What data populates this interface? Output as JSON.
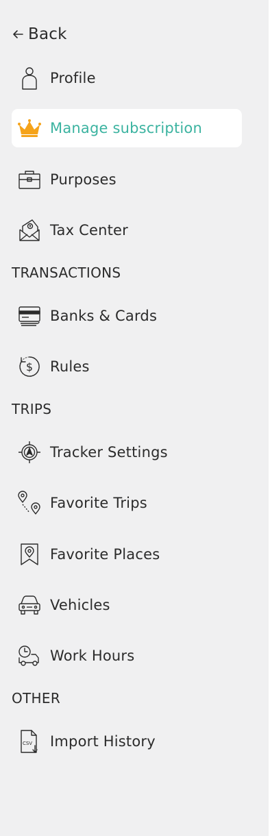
{
  "nav": {
    "back_label": "Back",
    "items": [
      {
        "label": "Profile",
        "icon": "person-icon"
      },
      {
        "label": "Manage subscription",
        "icon": "crown-icon",
        "active": true
      },
      {
        "label": "Purposes",
        "icon": "briefcase-icon"
      },
      {
        "label": "Tax Center",
        "icon": "tax-envelope-icon"
      }
    ],
    "sections": [
      {
        "title": "TRANSACTIONS",
        "items": [
          {
            "label": "Banks & Cards",
            "icon": "cards-icon"
          },
          {
            "label": "Rules",
            "icon": "dollar-cycle-icon"
          }
        ]
      },
      {
        "title": "TRIPS",
        "items": [
          {
            "label": "Tracker Settings",
            "icon": "navigation-target-icon"
          },
          {
            "label": "Favorite Trips",
            "icon": "route-pins-icon"
          },
          {
            "label": "Favorite Places",
            "icon": "map-pin-icon"
          },
          {
            "label": "Vehicles",
            "icon": "car-icon"
          },
          {
            "label": "Work Hours",
            "icon": "clock-truck-icon"
          }
        ]
      },
      {
        "title": "OTHER",
        "items": [
          {
            "label": "Import History",
            "icon": "csv-file-icon"
          }
        ]
      }
    ]
  },
  "colors": {
    "accent": "#3bb3a0",
    "crown": "#f5a31a",
    "background": "#f0f0f1",
    "active_background": "#ffffff",
    "text": "#2b2b2b"
  }
}
